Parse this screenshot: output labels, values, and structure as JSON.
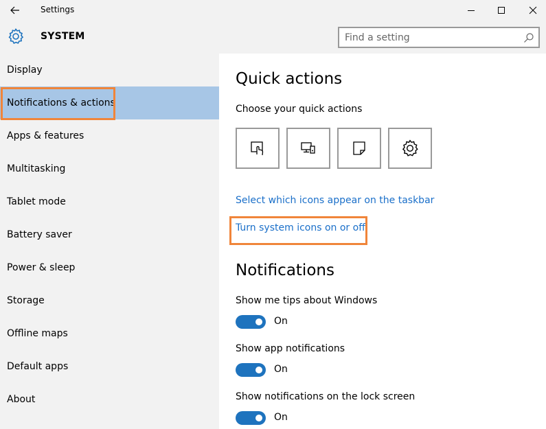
{
  "window": {
    "title": "Settings",
    "back_icon": "arrow-left-icon",
    "controls": [
      "minimize-icon",
      "maximize-icon",
      "close-icon"
    ]
  },
  "header": {
    "icon": "gear-icon",
    "title": "SYSTEM",
    "search_placeholder": "Find a setting",
    "search_icon": "search-icon"
  },
  "sidebar": {
    "items": [
      {
        "label": "Display"
      },
      {
        "label": "Notifications & actions",
        "selected": true
      },
      {
        "label": "Apps & features"
      },
      {
        "label": "Multitasking"
      },
      {
        "label": "Tablet mode"
      },
      {
        "label": "Battery saver"
      },
      {
        "label": "Power & sleep"
      },
      {
        "label": "Storage"
      },
      {
        "label": "Offline maps"
      },
      {
        "label": "Default apps"
      },
      {
        "label": "About"
      }
    ]
  },
  "main": {
    "quick_actions_heading": "Quick actions",
    "quick_actions_sub": "Choose your quick actions",
    "quick_action_tiles": [
      "tablet-mode-icon",
      "project-icon",
      "note-icon",
      "all-settings-icon"
    ],
    "link_taskbar_icons": "Select which icons appear on the taskbar",
    "link_system_icons": "Turn system icons on or off",
    "notifications_heading": "Notifications",
    "settings": [
      {
        "label": "Show me tips about Windows",
        "state": "On"
      },
      {
        "label": "Show app notifications",
        "state": "On"
      },
      {
        "label": "Show notifications on the lock screen",
        "state": "On"
      }
    ]
  },
  "colors": {
    "accent": "#1e73be",
    "link": "#1a6fc9",
    "selected_nav": "#a7c6e6",
    "highlight_annotation": "#f0853a"
  }
}
